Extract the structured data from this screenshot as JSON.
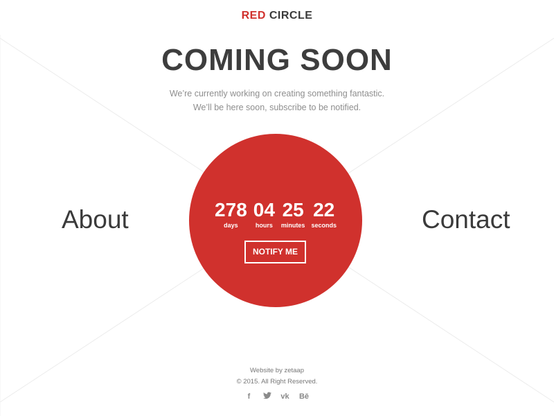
{
  "brand": {
    "part1": "RED",
    "part2": "CIRCLE",
    "accent_color": "#d0312d"
  },
  "hero": {
    "title": "COMING SOON",
    "subtitle_line1": "We’re currently working on creating something fantastic.",
    "subtitle_line2": "We’ll be here soon, subscribe to be notified."
  },
  "nav": {
    "about": "About",
    "contact": "Contact"
  },
  "countdown": [
    {
      "value": "278",
      "label": "days"
    },
    {
      "value": "04",
      "label": "hours"
    },
    {
      "value": "25",
      "label": "minutes"
    },
    {
      "value": "22",
      "label": "seconds"
    }
  ],
  "notify_button": "NOTIFY ME",
  "footer": {
    "credit": "Website by zetaap",
    "copyright": "© 2015. All Right Reserved."
  },
  "social": [
    {
      "icon": "facebook-icon",
      "glyph": "f"
    },
    {
      "icon": "twitter-icon",
      "glyph": ""
    },
    {
      "icon": "vk-icon",
      "glyph": "vk"
    },
    {
      "icon": "behance-icon",
      "glyph": "Bē"
    }
  ]
}
